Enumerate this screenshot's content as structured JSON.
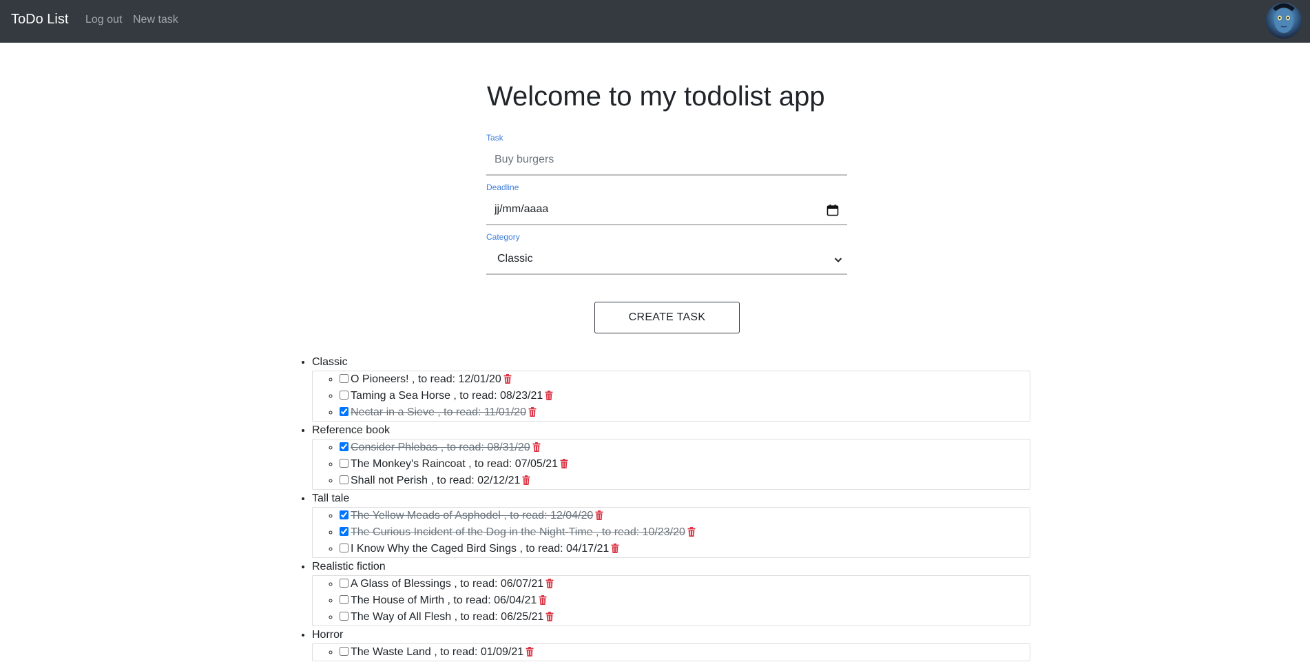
{
  "navbar": {
    "brand": "ToDo List",
    "links": [
      "Log out",
      "New task"
    ]
  },
  "main": {
    "title": "Welcome to my todolist app"
  },
  "form": {
    "task_label": "Task",
    "task_placeholder": "Buy burgers",
    "deadline_label": "Deadline",
    "deadline_value": "jj/mm/aaaa",
    "category_label": "Category",
    "category_value": "Classic",
    "submit_label": "CREATE TASK"
  },
  "categories": [
    {
      "name": "Classic",
      "tasks": [
        {
          "text": "O Pioneers! , to read: 12/01/20",
          "done": false
        },
        {
          "text": "Taming a Sea Horse , to read: 08/23/21",
          "done": false
        },
        {
          "text": "Nectar in a Sieve , to read: 11/01/20",
          "done": true
        }
      ]
    },
    {
      "name": "Reference book",
      "tasks": [
        {
          "text": "Consider Phlebas , to read: 08/31/20",
          "done": true
        },
        {
          "text": "The Monkey's Raincoat , to read: 07/05/21",
          "done": false
        },
        {
          "text": "Shall not Perish , to read: 02/12/21",
          "done": false
        }
      ]
    },
    {
      "name": "Tall tale",
      "tasks": [
        {
          "text": "The Yellow Meads of Asphodel , to read: 12/04/20",
          "done": true
        },
        {
          "text": "The Curious Incident of the Dog in the Night-Time , to read: 10/23/20",
          "done": true
        },
        {
          "text": "I Know Why the Caged Bird Sings , to read: 04/17/21",
          "done": false
        }
      ]
    },
    {
      "name": "Realistic fiction",
      "tasks": [
        {
          "text": "A Glass of Blessings , to read: 06/07/21",
          "done": false
        },
        {
          "text": "The House of Mirth , to read: 06/04/21",
          "done": false
        },
        {
          "text": "The Way of All Flesh , to read: 06/25/21",
          "done": false
        }
      ]
    },
    {
      "name": "Horror",
      "tasks": [
        {
          "text": "The Waste Land , to read: 01/09/21",
          "done": false
        }
      ]
    }
  ],
  "colors": {
    "navbar_bg": "#343a40",
    "label_blue": "#3f7fdc",
    "trash_red": "#dc3545"
  },
  "icons": {
    "calendar": "calendar-icon",
    "chevron": "chevron-down-icon",
    "trash": "trash-icon",
    "avatar": "avatar"
  }
}
